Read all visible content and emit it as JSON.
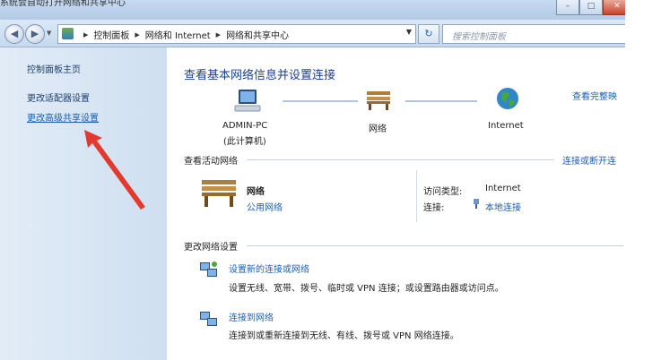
{
  "top_caption": "系统会自动打开网络和共享中心",
  "window": {
    "minimize": "–",
    "maximize": "□",
    "close": "✕"
  },
  "nav": {
    "back_glyph": "◀",
    "forward_glyph": "▶",
    "breadcrumbs": [
      "控制面板",
      "网络和 Internet",
      "网络和共享中心"
    ],
    "search_placeholder": "搜索控制面板",
    "refresh_glyph": "↻"
  },
  "sidebar": {
    "items": [
      {
        "label": "控制面板主页"
      },
      {
        "label": "更改适配器设置"
      },
      {
        "label": "更改高级共享设置"
      }
    ],
    "annotation_color": "#e23a2e"
  },
  "main": {
    "title": "查看基本网络信息并设置连接",
    "full_map": "查看完整映",
    "nodes": [
      {
        "label": "ADMIN-PC",
        "sub": "(此计算机)",
        "icon": "computer-icon"
      },
      {
        "label": "网络",
        "icon": "bench-icon"
      },
      {
        "label": "Internet",
        "icon": "globe-icon"
      }
    ],
    "active": {
      "heading": "查看活动网络",
      "connect_link": "连接或断开连",
      "network_name": "网络",
      "network_type": "公用网络",
      "access_label": "访问类型:",
      "access_value": "Internet",
      "conn_label": "连接:",
      "conn_value": "本地连接"
    },
    "change": {
      "heading": "更改网络设置",
      "tasks": [
        {
          "link": "设置新的连接或网络",
          "desc": "设置无线、宽带、拨号、临时或 VPN 连接；或设置路由器或访问点。"
        },
        {
          "link": "连接到网络",
          "desc": "连接到或重新连接到无线、有线、拨号或 VPN 网络连接。"
        }
      ]
    }
  },
  "colors": {
    "link": "#1a5fb4",
    "title": "#1e3f8c"
  }
}
